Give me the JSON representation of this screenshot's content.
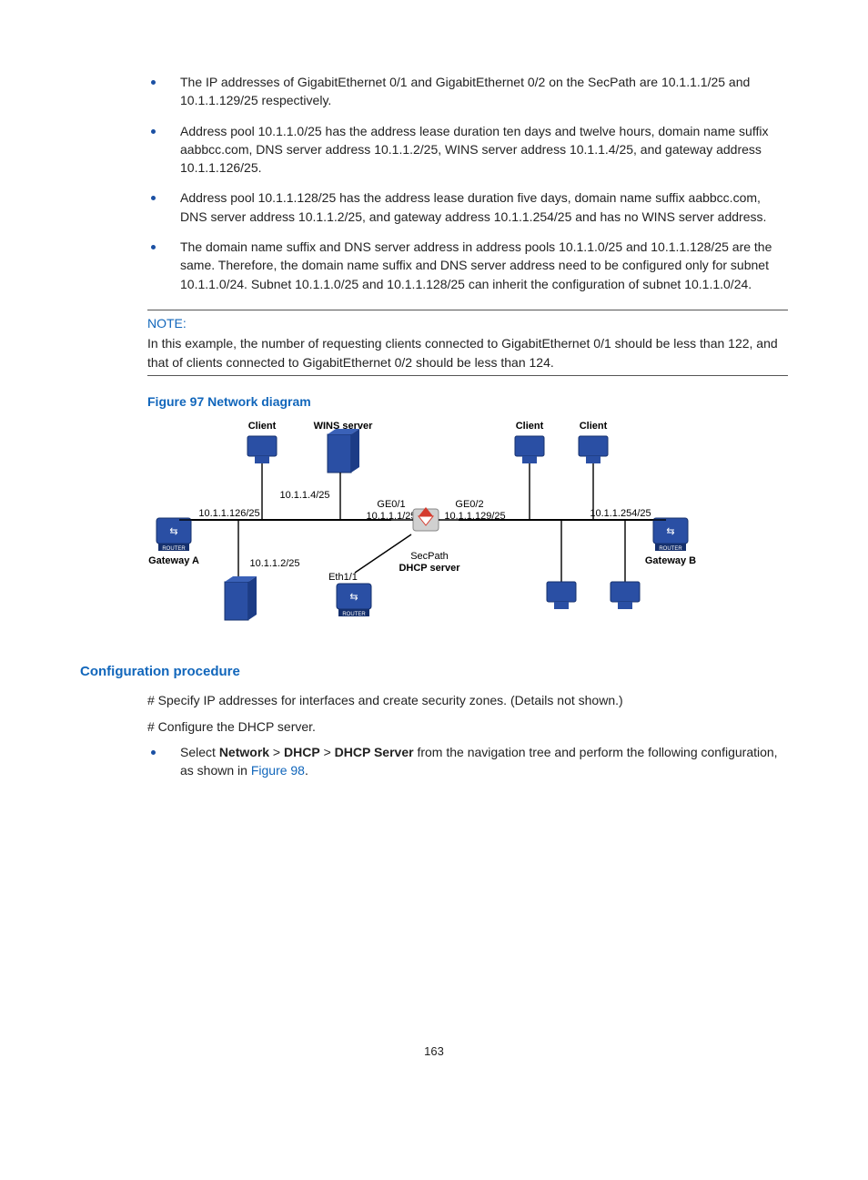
{
  "bullets_top": [
    "The IP addresses of GigabitEthernet 0/1 and GigabitEthernet 0/2 on the SecPath are 10.1.1.1/25 and 10.1.1.129/25 respectively.",
    "Address pool 10.1.1.0/25 has the address lease duration ten days and twelve hours, domain name suffix aabbcc.com, DNS server address 10.1.1.2/25, WINS server address 10.1.1.4/25, and gateway address 10.1.1.126/25.",
    "Address pool 10.1.1.128/25 has the address lease duration five days, domain name suffix aabbcc.com, DNS server address 10.1.1.2/25, and gateway address 10.1.1.254/25 and has no WINS server address.",
    "The domain name suffix and DNS server address in address pools 10.1.1.0/25 and 10.1.1.128/25 are the same. Therefore, the domain name suffix and DNS server address need to be configured only for subnet 10.1.1.0/24. Subnet 10.1.1.0/25 and 10.1.1.128/25 can inherit the configuration of subnet 10.1.1.0/24."
  ],
  "note": {
    "label": "NOTE:",
    "body": "In this example, the number of requesting clients connected to GigabitEthernet 0/1 should be less than 122, and that of clients connected to GigabitEthernet 0/2 should be less than 124."
  },
  "figure": {
    "caption": "Figure 97 Network diagram",
    "labels": {
      "client_l": "Client",
      "wins": "WINS server",
      "client_r1": "Client",
      "client_r2": "Client",
      "wins_ip": "10.1.1.4/25",
      "ge01": "GE0/1",
      "ge01_ip": "10.1.1.1/25",
      "ge02": "GE0/2",
      "ge02_ip": "10.1.1.129/25",
      "gwA_ip": "10.1.1.126/25",
      "gwB_ip": "10.1.1.254/25",
      "gwA": "Gateway A",
      "gwB": "Gateway B",
      "dns_ip": "10.1.1.2/25",
      "eth11": "Eth1/1",
      "secpath": "SecPath",
      "dhcp": "DHCP server"
    }
  },
  "section_heading": "Configuration procedure",
  "para1": "# Specify IP addresses for interfaces and create security zones. (Details not shown.)",
  "para2": "# Configure the DHCP server.",
  "config_bullet": {
    "pre": "Select ",
    "b1": "Network",
    "sep": " > ",
    "b2": "DHCP",
    "b3": "DHCP Server",
    "post1": " from the navigation tree and perform the following configuration, as shown in ",
    "link": "Figure 98",
    "post2": "."
  },
  "page_number": "163"
}
